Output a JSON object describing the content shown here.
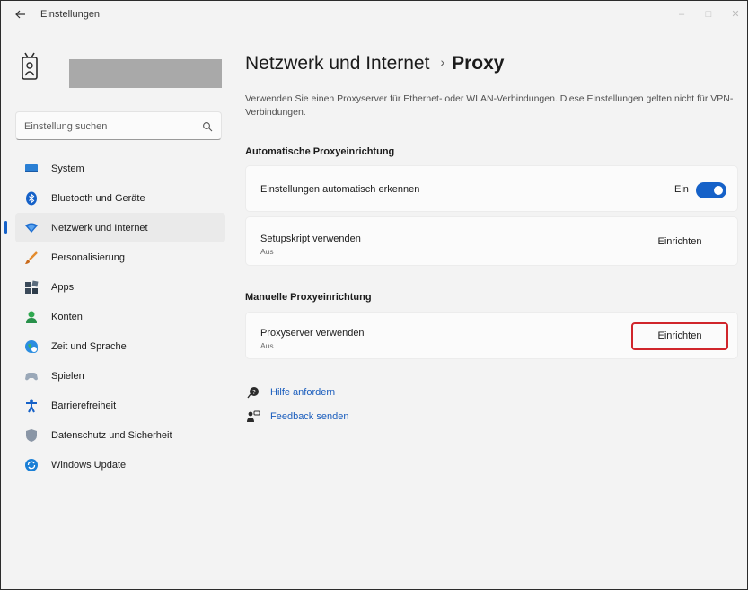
{
  "window": {
    "title": "Einstellungen",
    "back_icon": "back-arrow-icon",
    "minimize_glyph": "–",
    "maximize_glyph": "□",
    "close_glyph": "✕"
  },
  "sidebar": {
    "search_placeholder": "Einstellung suchen",
    "items": [
      {
        "label": "System",
        "icon": "system-icon"
      },
      {
        "label": "Bluetooth und Geräte",
        "icon": "bluetooth-icon"
      },
      {
        "label": "Netzwerk und Internet",
        "icon": "network-icon",
        "active": true
      },
      {
        "label": "Personalisierung",
        "icon": "brush-icon"
      },
      {
        "label": "Apps",
        "icon": "apps-icon"
      },
      {
        "label": "Konten",
        "icon": "account-icon"
      },
      {
        "label": "Zeit und Sprache",
        "icon": "globe-clock-icon"
      },
      {
        "label": "Spielen",
        "icon": "gamepad-icon"
      },
      {
        "label": "Barrierefreiheit",
        "icon": "accessibility-icon"
      },
      {
        "label": "Datenschutz und Sicherheit",
        "icon": "shield-icon"
      },
      {
        "label": "Windows Update",
        "icon": "update-icon"
      }
    ]
  },
  "header": {
    "parent": "Netzwerk und Internet",
    "separator": "›",
    "current": "Proxy",
    "description": "Verwenden Sie einen Proxyserver für Ethernet- oder WLAN-Verbindungen. Diese Einstellungen gelten nicht für VPN-Verbindungen."
  },
  "auto_section": {
    "title": "Automatische Proxyeinrichtung",
    "detect": {
      "label": "Einstellungen automatisch erkennen",
      "state_label": "Ein",
      "on": true
    },
    "script": {
      "label": "Setupskript verwenden",
      "status": "Aus",
      "button": "Einrichten"
    }
  },
  "manual_section": {
    "title": "Manuelle Proxyeinrichtung",
    "proxy": {
      "label": "Proxyserver verwenden",
      "status": "Aus",
      "button": "Einrichten"
    }
  },
  "links": [
    {
      "label": "Hilfe anfordern",
      "icon": "help-icon"
    },
    {
      "label": "Feedback senden",
      "icon": "feedback-icon"
    }
  ],
  "colors": {
    "accent": "#1561c8",
    "highlight": "#d0252b",
    "link": "#1a5dbd"
  }
}
